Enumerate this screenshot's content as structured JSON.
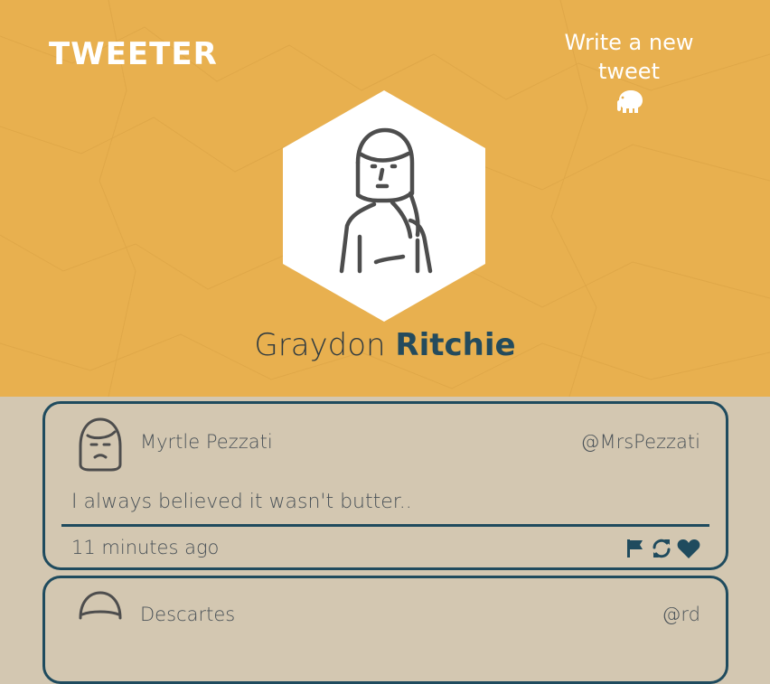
{
  "header": {
    "logo": "TWEETER",
    "compose_label": "Write a new tweet",
    "compose_icon": "elephant-icon",
    "profile_first_name": "Graydon",
    "profile_last_name": "Ritchie"
  },
  "tweets": [
    {
      "name": "Myrtle Pezzati",
      "handle": "@MrsPezzati",
      "content": "I always believed it wasn't butter..",
      "time": "11 minutes ago",
      "actions": [
        "flag-icon",
        "retweet-icon",
        "heart-icon"
      ]
    },
    {
      "name": "Descartes",
      "handle": "@rd"
    }
  ],
  "colors": {
    "header_bg": "#e8b04f",
    "page_bg": "#d3c7b1",
    "accent": "#1f4b5e"
  }
}
